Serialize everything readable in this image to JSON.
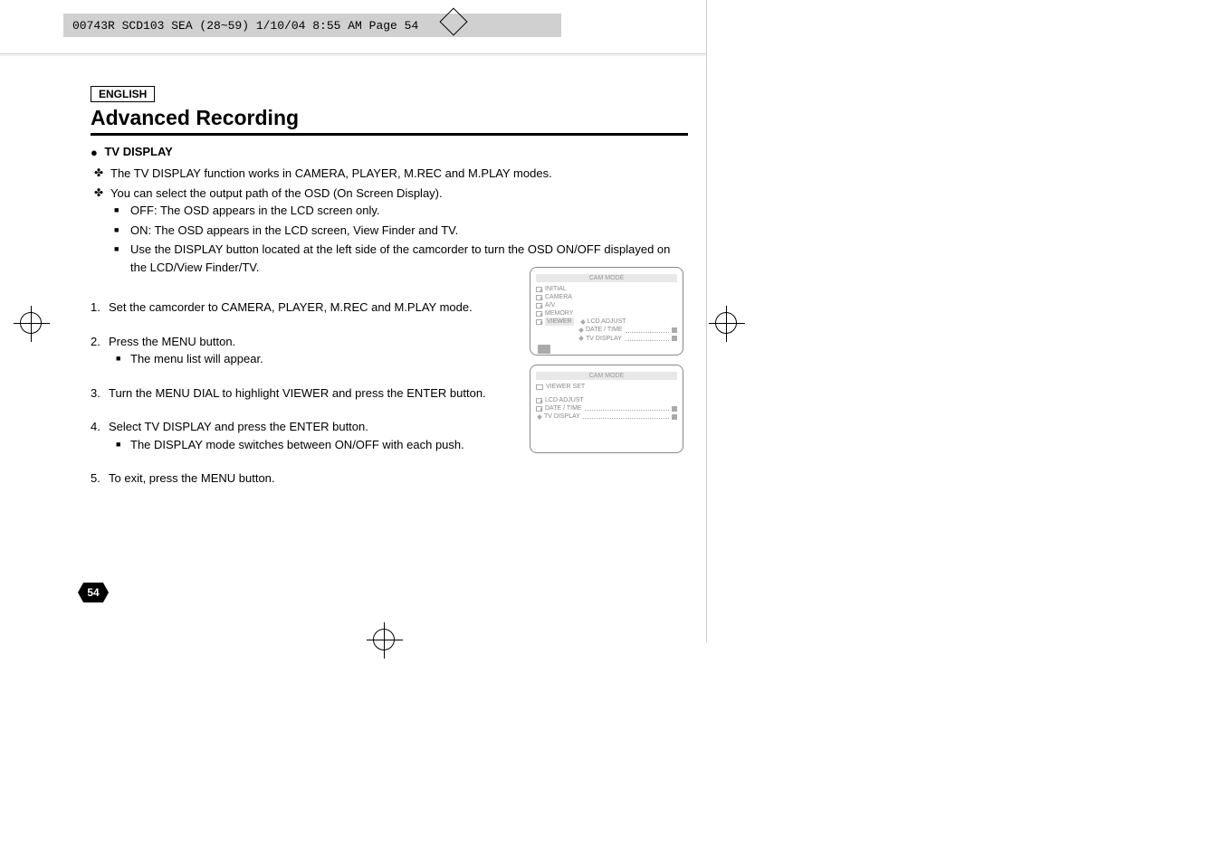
{
  "header": {
    "text": "00743R SCD103 SEA (28~59)  1/10/04 8:55 AM  Page 54"
  },
  "lang": "ENGLISH",
  "main_heading": "Advanced Recording",
  "section_title": "TV DISPLAY",
  "intro": [
    "The TV DISPLAY function works in CAMERA, PLAYER, M.REC and M.PLAY modes.",
    "You can select the output path of the OSD (On Screen Display)."
  ],
  "sub_intro": [
    "OFF: The OSD appears in the LCD screen only.",
    "ON: The OSD appears in the LCD screen, View Finder and TV.",
    "Use the DISPLAY button located at the left side of the camcorder to turn the OSD ON/OFF displayed on the LCD/View Finder/TV."
  ],
  "steps": [
    {
      "num": "1.",
      "text": "Set the camcorder to CAMERA, PLAYER, M.REC and M.PLAY mode."
    },
    {
      "num": "2.",
      "text": "Press the MENU button.",
      "sub": [
        "The menu list will appear."
      ]
    },
    {
      "num": "3.",
      "text": "Turn the MENU DIAL to highlight VIEWER and press the ENTER button."
    },
    {
      "num": "4.",
      "text": "Select TV DISPLAY and press the ENTER button.",
      "sub": [
        "The DISPLAY mode switches between ON/OFF with each push."
      ]
    },
    {
      "num": "5.",
      "text": "To exit, press the MENU button."
    }
  ],
  "page_number": "54",
  "screen1": {
    "title": "CAM  MODE",
    "items": [
      "INITIAL",
      "CAMERA",
      "A/V",
      "MEMORY",
      "VIEWER"
    ],
    "sub_items": [
      "LCD ADJUST",
      "DATE / TIME",
      "TV DISPLAY"
    ]
  },
  "screen2": {
    "title": "CAM  MODE",
    "set_label": "VIEWER SET",
    "items": [
      "LCD ADJUST",
      "DATE / TIME",
      "TV DISPLAY"
    ]
  }
}
